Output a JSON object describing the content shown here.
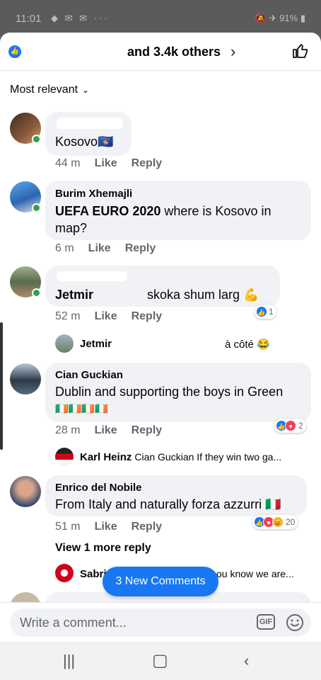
{
  "status_bar": {
    "time": "11:01",
    "battery": "91%"
  },
  "header": {
    "reactors": "and 3.4k others",
    "like_badge": "👍"
  },
  "sort": {
    "label": "Most relevant"
  },
  "comments": [
    {
      "author": "",
      "text": "Kosovo🇽🇰",
      "time": "44 m",
      "like": "Like",
      "reply": "Reply"
    },
    {
      "author": "Burim Xhemajli",
      "text_bold": "UEFA EURO 2020",
      "text": " where is Kosovo in map?",
      "time": "6 m",
      "like": "Like",
      "reply": "Reply"
    },
    {
      "author": "",
      "text_name": "Jetmir",
      "text": "skoka shum larg 💪",
      "time": "52 m",
      "like": "Like",
      "reply": "Reply",
      "reaction_count": "1"
    },
    {
      "author": "Cian Guckian",
      "text": "Dublin and supporting the boys in Green",
      "flags": "🇮🇪🇮🇪🇮🇪🇮🇪",
      "time": "28 m",
      "like": "Like",
      "reply": "Reply",
      "reaction_count": "2"
    },
    {
      "author": "Enrico del Nobile",
      "text": "From Italy and naturally forza azzurri 🇮🇹",
      "time": "51 m",
      "like": "Like",
      "reply": "Reply",
      "reaction_count": "20"
    }
  ],
  "replies": [
    {
      "author": "Jetmir",
      "text": "à côté 😂"
    },
    {
      "author": "Karl Heinz",
      "text": "Cian Guckian If they win two ga..."
    },
    {
      "author": "Sabri",
      "text": "ou know we are..."
    }
  ],
  "view_more": "View 1 more reply",
  "new_comments": "3 New Comments",
  "composer": {
    "placeholder": "Write a comment...",
    "gif": "GIF"
  }
}
